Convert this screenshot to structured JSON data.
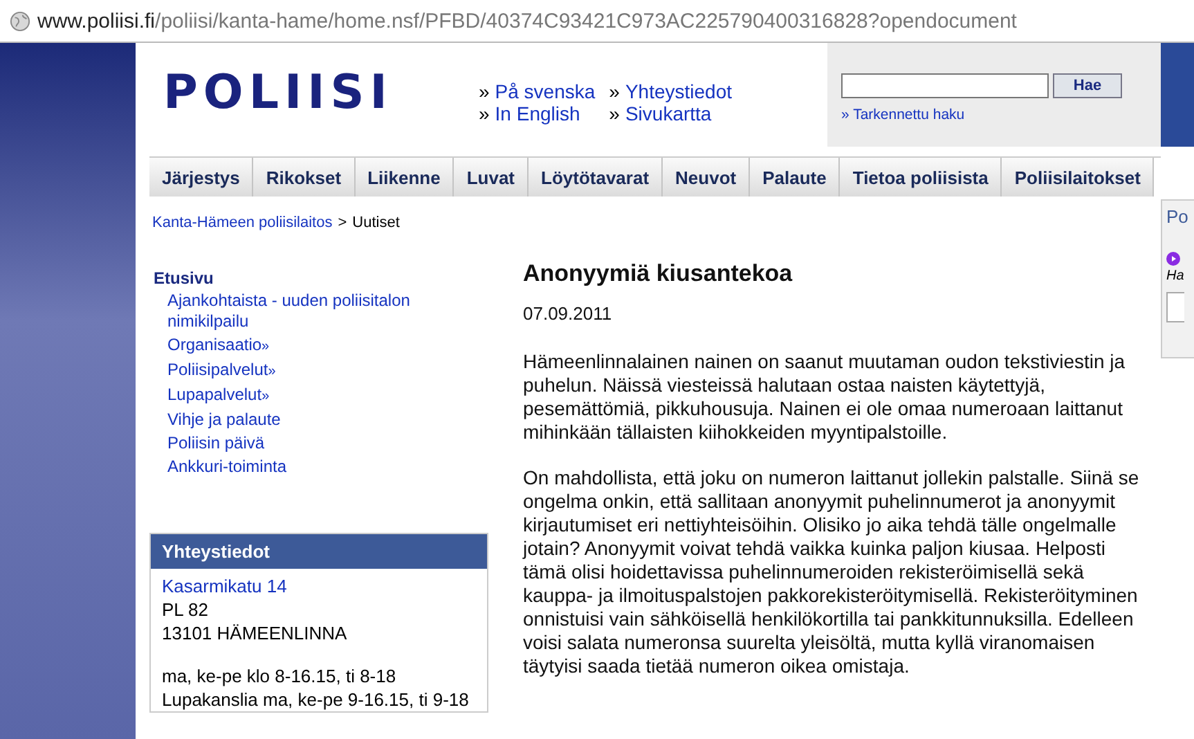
{
  "address_bar": {
    "domain": "www.poliisi.fi",
    "path": "/poliisi/kanta-hame/home.nsf/PFBD/40374C93421C973AC225790400316828?opendocument"
  },
  "header": {
    "logo": "POLIISI",
    "links": [
      {
        "marker": "»",
        "label": "På svenska"
      },
      {
        "marker": "»",
        "label": "In English"
      },
      {
        "marker": "»",
        "label": "Yhteystiedot"
      },
      {
        "marker": "»",
        "label": "Sivukartta"
      }
    ],
    "search": {
      "button": "Hae",
      "advanced": "» Tarkennettu haku"
    }
  },
  "nav": [
    {
      "label": "Järjestys"
    },
    {
      "label": "Rikokset"
    },
    {
      "label": "Liikenne"
    },
    {
      "label": "Luvat"
    },
    {
      "label": "Löytötavarat"
    },
    {
      "label": "Neuvot"
    },
    {
      "label": "Palaute"
    },
    {
      "label": "Tietoa poliisista"
    },
    {
      "label": "Poliisilaitokset"
    }
  ],
  "breadcrumb": {
    "link": "Kanta-Hämeen poliisilaitos",
    "separator": ">",
    "current": "Uutiset"
  },
  "sidebar": {
    "heading": "Etusivu",
    "items": [
      {
        "label": "Ajankohtaista - uuden poliisitalon nimikilpailu",
        "more": false
      },
      {
        "label": "Organisaatio",
        "more": true
      },
      {
        "label": "Poliisipalvelut",
        "more": true
      },
      {
        "label": "Lupapalvelut",
        "more": true
      },
      {
        "label": "Vihje ja palaute",
        "more": false
      },
      {
        "label": "Poliisin päivä",
        "more": false
      },
      {
        "label": "Ankkuri-toiminta",
        "more": false
      }
    ]
  },
  "contact": {
    "title": "Yhteystiedot",
    "street": "Kasarmikatu 14",
    "lines": [
      "PL 82",
      "13101 HÄMEENLINNA"
    ],
    "hours": [
      "ma, ke-pe klo 8-16.15, ti 8-18",
      "Lupakanslia ma, ke-pe 9-16.15, ti 9-18"
    ]
  },
  "article": {
    "title": "Anonyymiä kiusantekoa",
    "date": "07.09.2011",
    "paragraphs": [
      "Hämeenlinnalainen nainen on saanut muutaman oudon tekstiviestin ja puhelun. Näissä viesteissä halutaan ostaa naisten käytettyjä, pesemättömiä, pikkuhousuja. Nainen ei ole omaa numeroaan laittanut mihinkään tällaisten kiihokkeiden myyntipalstoille.",
      "On mahdollista, että joku on numeron laittanut jollekin palstalle. Siinä se ongelma onkin, että sallitaan anonyymit puhelinnumerot ja anonyymit kirjautumiset eri nettiyhteisöihin. Olisiko jo aika tehdä tälle ongelmalle jotain? Anonyymit voivat tehdä vaikka kuinka paljon kiusaa. Helposti tämä olisi hoidettavissa puhelinnumeroiden rekisteröimisellä sekä kauppa- ja ilmoituspalstojen pakkorekisteröitymisellä. Rekisteröityminen onnistuisi vain sähköisellä henkilökortilla tai pankkitunnuksilla. Edelleen voisi salata numeronsa suurelta yleisöltä, mutta kyllä viranomaisen täytyisi saada tietää numeron oikea omistaja."
    ]
  },
  "side_panel": {
    "title": "Po",
    "label": "Ha"
  }
}
